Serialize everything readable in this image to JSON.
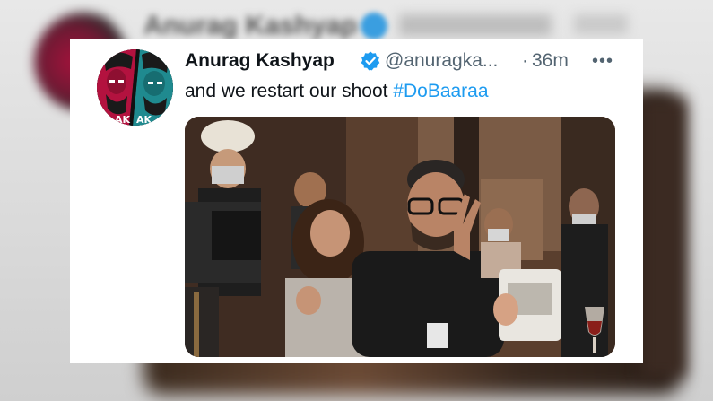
{
  "tweet": {
    "display_name": "Anurag Kashyap",
    "handle": "@anuragka...",
    "separator": "·",
    "time": "36m",
    "more_label": "•••",
    "text": "and we restart our shoot ",
    "hashtag": "#DoBaaraa",
    "avatar_text": "AK"
  },
  "colors": {
    "link": "#1d9bf0",
    "verified": "#1d9bf0",
    "secondary_text": "#536471"
  },
  "icons": {
    "verified": "verified-badge-icon",
    "more": "more-options-icon"
  }
}
